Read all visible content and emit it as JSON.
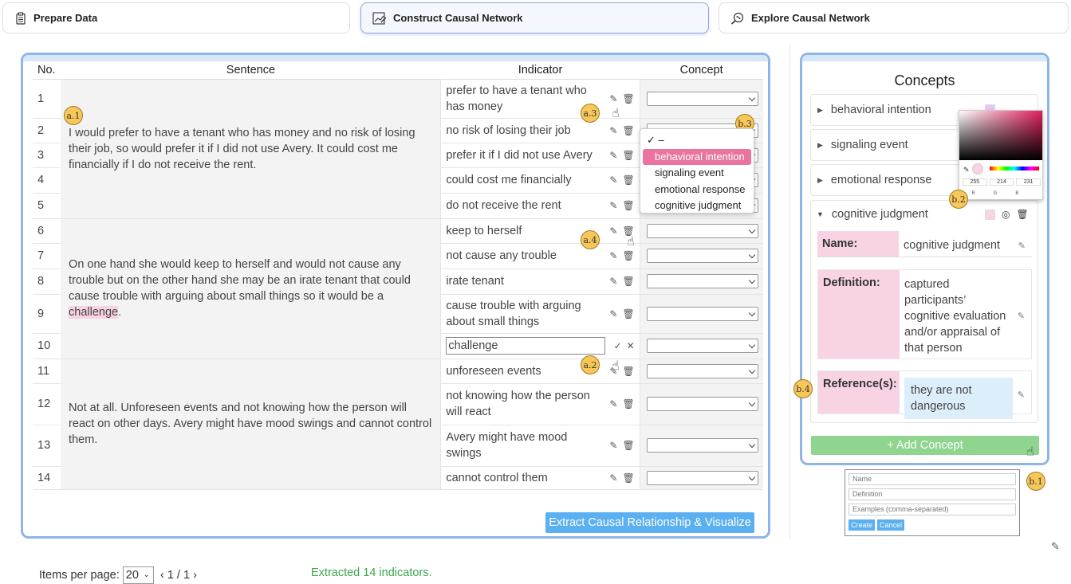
{
  "tabs": [
    {
      "label": "Prepare Data",
      "icon": "clipboard-icon"
    },
    {
      "label": "Construct Causal Network",
      "icon": "chart-edit-icon"
    },
    {
      "label": "Explore Causal Network",
      "icon": "search-network-icon"
    }
  ],
  "table": {
    "headers": {
      "no": "No.",
      "sentence": "Sentence",
      "indicator": "Indicator",
      "concept": "Concept"
    },
    "sentences": [
      {
        "text": "I would prefer to have a tenant who has money and no risk of losing their job, so would prefer it if I did not use Avery. It could cost me financially if I do not receive the rent."
      },
      {
        "text_before": "On one hand she would keep to herself and would not cause any trouble but on the other hand she may be an irate tenant that could cause trouble with arguing about small things so it would be a ",
        "highlight": "challenge",
        "text_after": "."
      },
      {
        "text": "Not at all. Unforeseen events and not knowing how the person will react on other days. Avery might have mood swings and cannot control them."
      }
    ],
    "rows": [
      {
        "no": "1",
        "indicator": "prefer to have a tenant who has money"
      },
      {
        "no": "2",
        "indicator": "no risk of losing their job"
      },
      {
        "no": "3",
        "indicator": "prefer it if I did not use Avery"
      },
      {
        "no": "4",
        "indicator": "could cost me financially"
      },
      {
        "no": "5",
        "indicator": "do not receive the rent"
      },
      {
        "no": "6",
        "indicator": "keep to herself"
      },
      {
        "no": "7",
        "indicator": "not cause any trouble"
      },
      {
        "no": "8",
        "indicator": "irate tenant"
      },
      {
        "no": "9",
        "indicator": "cause trouble with arguing about small things"
      },
      {
        "no": "10",
        "indicator": "challenge"
      },
      {
        "no": "11",
        "indicator": "unforeseen events"
      },
      {
        "no": "12",
        "indicator": "not knowing how the person will react"
      },
      {
        "no": "13",
        "indicator": "Avery might have mood swings"
      },
      {
        "no": "14",
        "indicator": "cannot control them"
      }
    ]
  },
  "dropdown": {
    "options": [
      "–",
      "behavioral intention",
      "signaling event",
      "emotional response",
      "cognitive judgment"
    ],
    "selected": "behavioral intention"
  },
  "footer": {
    "items_per_page_label": "Items per page:",
    "items_per_page": "20",
    "page_info": "1 / 1",
    "prev": "‹",
    "next": "›",
    "status": "Extracted 14 indicators.",
    "extract_button": "Extract Causal Relationship & Visualize"
  },
  "concepts": {
    "title": "Concepts",
    "items": [
      "behavioral intention",
      "signaling event",
      "emotional response",
      "cognitive judgment"
    ],
    "expanded": {
      "name_label": "Name:",
      "name_value": "cognitive judgment",
      "definition_label": "Definition:",
      "definition_value": "captured participants’ cognitive evaluation and/or appraisal of that person",
      "reference_label": "Reference(s):",
      "reference_value": "they are not dangerous"
    },
    "add_button": "+ Add Concept"
  },
  "color_picker": {
    "r": "255",
    "g": "214",
    "b": "231",
    "r_label": "R",
    "g_label": "G",
    "b_label": "B"
  },
  "new_concept_form": {
    "name_placeholder": "Name",
    "definition_placeholder": "Definition",
    "examples_placeholder": "Examples (comma-separated)",
    "create": "Create",
    "cancel": "Cancel"
  },
  "badges": {
    "a1": "a.1",
    "a2": "a.2",
    "a3": "a.3",
    "a4": "a.4",
    "b1": "b.1",
    "b2": "b.2",
    "b3": "b.3",
    "b4": "b.4"
  },
  "colors": {
    "accent": "#8fb4e8",
    "highlight": "#f8d3e3",
    "dropdown_selected": "#e8749f",
    "button_blue": "#5ab0f0",
    "button_green": "#8fd48f",
    "status_green": "#3aa84a"
  }
}
